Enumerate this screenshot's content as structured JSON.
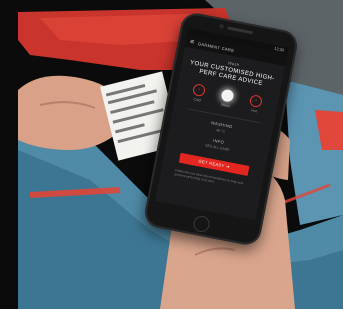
{
  "phone_screen": {
    "status_time": "12:30",
    "app_title": "GARMENT CARE",
    "menu_icon": "menu-icon",
    "subheading": "Wash",
    "headline": "YOUR CUSTOMISED HIGH-PERF CARE ADVICE",
    "options": [
      {
        "label": "Cold",
        "icon": "wash-cold-icon",
        "selected": false
      },
      {
        "label": "Warm",
        "icon": "wash-warm-icon",
        "selected": true
      },
      {
        "label": "Hot",
        "icon": "wash-hot-icon",
        "selected": false
      }
    ],
    "section_label": "WASHING",
    "section_value": "40 °C",
    "secondary_label": "INFO",
    "secondary_value": "SEE ALL CARE",
    "cta_label": "GET READY ➜",
    "footnote": "Follow the care label recommendations to keep your garment performing at its best."
  },
  "colors": {
    "accent": "#e3261f",
    "jacket_red": "#d8382f",
    "jacket_blue": "#4f8aa6",
    "background": "#0b0b0b"
  }
}
